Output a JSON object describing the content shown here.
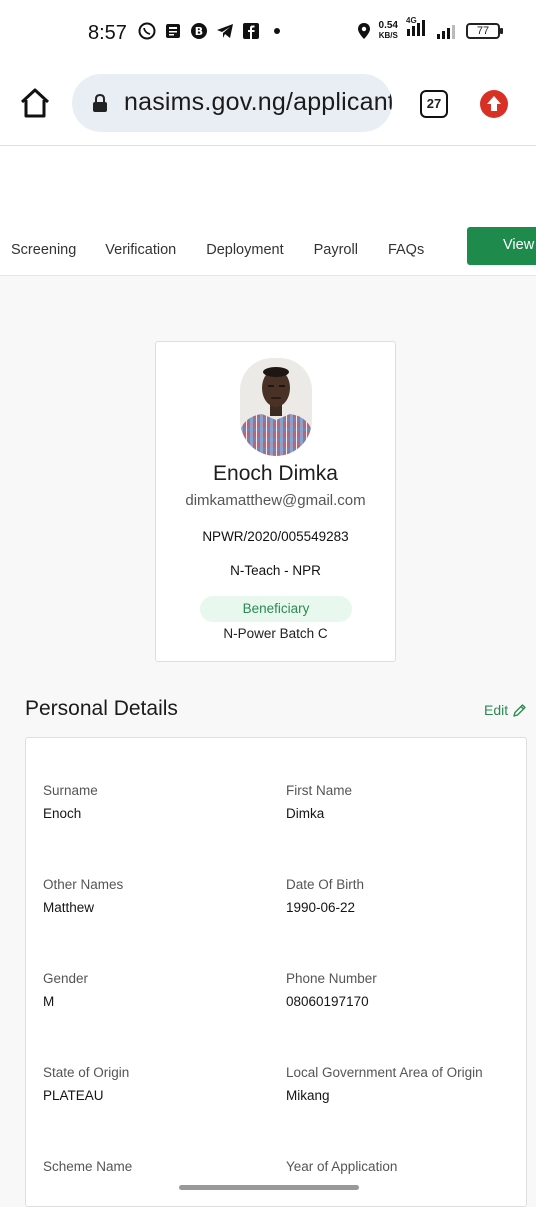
{
  "status_bar": {
    "time": "8:57",
    "net_speed_value": "0.54",
    "net_speed_unit": "KB/S",
    "network": "4G",
    "battery": "77"
  },
  "browser": {
    "url": "nasims.gov.ng/applicant",
    "tab_count": "27"
  },
  "nav": {
    "items": [
      "Screening",
      "Verification",
      "Deployment",
      "Payroll",
      "FAQs"
    ],
    "view_button": "View"
  },
  "profile": {
    "full_name": "Enoch Dimka",
    "email": "dimkamatthew@gmail.com",
    "application_id": "NPWR/2020/005549283",
    "program": "N-Teach - NPR",
    "status_badge": "Beneficiary",
    "batch": "N-Power Batch C"
  },
  "personal_details": {
    "title": "Personal Details",
    "edit_label": "Edit",
    "fields": [
      {
        "label": "Surname",
        "value": "Enoch"
      },
      {
        "label": "First Name",
        "value": "Dimka"
      },
      {
        "label": "Other Names",
        "value": "Matthew"
      },
      {
        "label": "Date Of Birth",
        "value": "1990-06-22"
      },
      {
        "label": "Gender",
        "value": "M"
      },
      {
        "label": "Phone Number",
        "value": "08060197170"
      },
      {
        "label": "State of Origin",
        "value": "PLATEAU"
      },
      {
        "label": "Local Government Area of Origin",
        "value": "Mikang"
      },
      {
        "label": "Scheme Name",
        "value": ""
      },
      {
        "label": "Year of Application",
        "value": ""
      }
    ]
  },
  "colors": {
    "accent_green": "#1e8a4c",
    "badge_bg": "#e9f8ef",
    "upgrade_red": "#d93025"
  }
}
